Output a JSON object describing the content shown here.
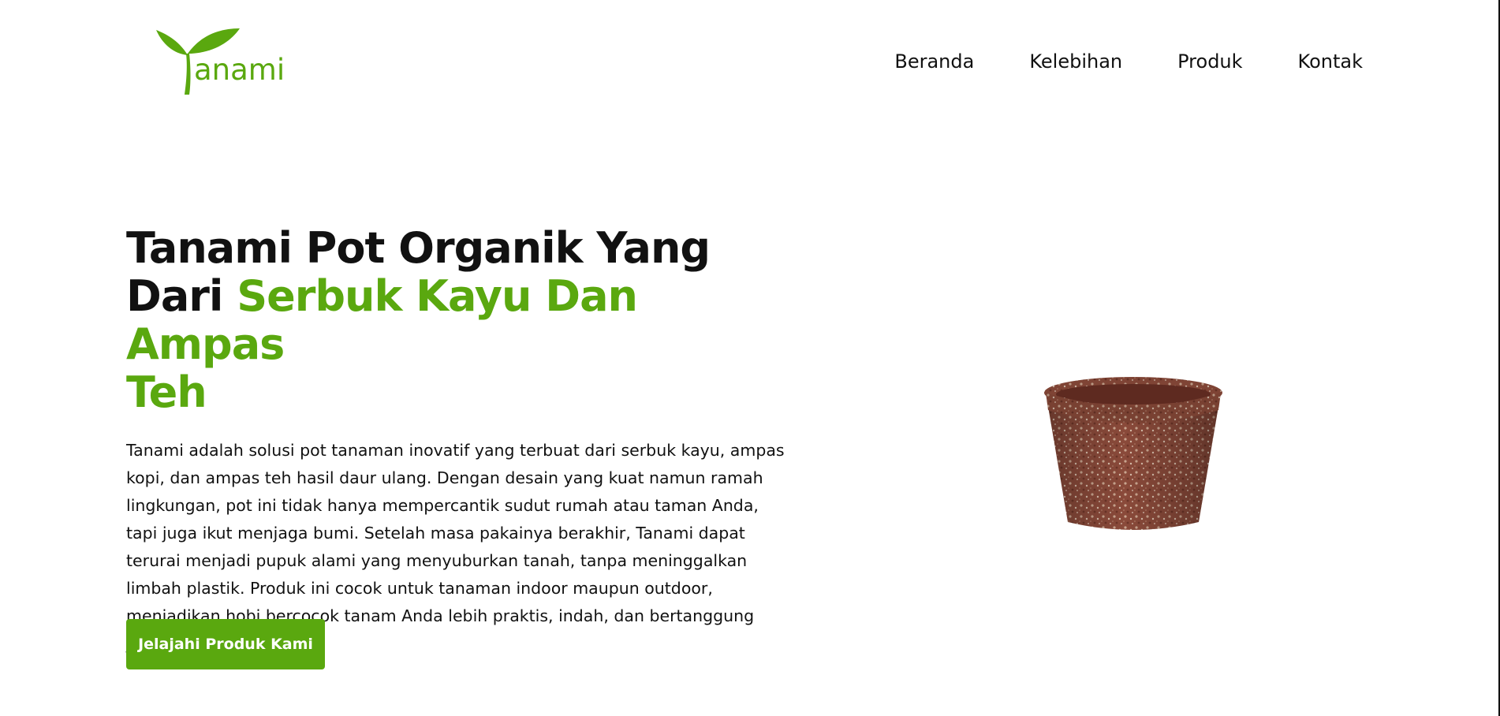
{
  "brand": {
    "logo_text": "anami",
    "accent_color": "#5aa80f"
  },
  "nav": {
    "items": [
      {
        "label": "Beranda"
      },
      {
        "label": "Kelebihan"
      },
      {
        "label": "Produk"
      },
      {
        "label": "Kontak"
      }
    ]
  },
  "hero": {
    "title_line1": "Tanami Pot Organik Yang",
    "title_line2_plain": "Dari",
    "title_line2_accent": "Serbuk Kayu Dan Ampas",
    "title_line3_accent": "Teh",
    "description": "Tanami adalah solusi pot tanaman inovatif yang terbuat dari serbuk kayu, ampas kopi, dan ampas teh hasil daur ulang. Dengan desain yang kuat namun ramah lingkungan, pot ini tidak hanya mempercantik sudut rumah atau taman Anda, tapi juga ikut menjaga bumi. Setelah masa pakainya berakhir, Tanami dapat terurai menjadi pupuk alami yang menyuburkan tanah, tanpa meninggalkan limbah plastik. Produk ini cocok untuk tanaman indoor maupun outdoor, menjadikan hobi bercocok tanam Anda lebih praktis, indah, dan bertanggung jawab terhadap alam.",
    "cta_label": "Jelajahi Produk Kami"
  },
  "icons": {
    "logo": "sprout-icon",
    "product_image": "organic-pot-image"
  }
}
